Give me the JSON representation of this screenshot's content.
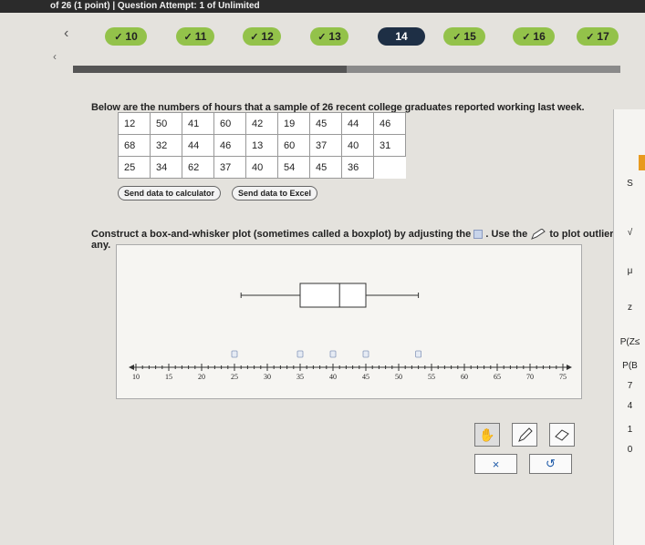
{
  "header": {
    "title": "of 26 (1 point) | Question Attempt: 1 of Unlimited"
  },
  "nav": {
    "prev_icon": "chevron-left-icon",
    "questions": [
      {
        "label": "10",
        "done": true
      },
      {
        "label": "11",
        "done": true
      },
      {
        "label": "12",
        "done": true
      },
      {
        "label": "13",
        "done": true
      },
      {
        "label": "14",
        "done": false
      },
      {
        "label": "15",
        "done": true
      },
      {
        "label": "16",
        "done": true
      },
      {
        "label": "17",
        "done": true
      }
    ],
    "check_mark": "✓"
  },
  "question": {
    "prompt": "Below are the numbers of hours that a sample of 26 recent college graduates reported working last week.",
    "table": [
      [
        "12",
        "50",
        "41",
        "60",
        "42",
        "19",
        "45",
        "44",
        "46"
      ],
      [
        "68",
        "32",
        "44",
        "46",
        "13",
        "60",
        "37",
        "40",
        "31"
      ],
      [
        "25",
        "34",
        "62",
        "37",
        "40",
        "54",
        "45",
        "36"
      ]
    ],
    "calc_button": "Send data to calculator",
    "excel_button": "Send data to Excel",
    "instruction_part1": "Construct a box-and-whisker plot (sometimes called a boxplot) by adjusting the ",
    "instruction_part2": ". Use the ",
    "instruction_part3": " to plot outliers, if any."
  },
  "plot": {
    "axis_ticks": [
      "10",
      "15",
      "20",
      "25",
      "30",
      "35",
      "40",
      "45",
      "50",
      "55",
      "60",
      "65",
      "70",
      "75"
    ],
    "axis_min": 10,
    "axis_max": 75,
    "whisker_low": 26,
    "q1": 35,
    "median": 41,
    "q3": 45,
    "whisker_high": 53,
    "handles": [
      25,
      35,
      40,
      45,
      53
    ]
  },
  "tools": {
    "hand_icon": "hand-icon",
    "pencil_icon": "pencil-icon",
    "eraser_icon": "eraser-icon"
  },
  "actions": {
    "clear_label": "×",
    "undo_label": "↺"
  },
  "side_panel": {
    "items": [
      "S",
      "√",
      "μ",
      "z",
      "P(Z≤",
      "P(B",
      "7",
      "4",
      "1",
      "0"
    ]
  },
  "colors": {
    "done": "#93c24a",
    "current": "#1e2f45"
  }
}
